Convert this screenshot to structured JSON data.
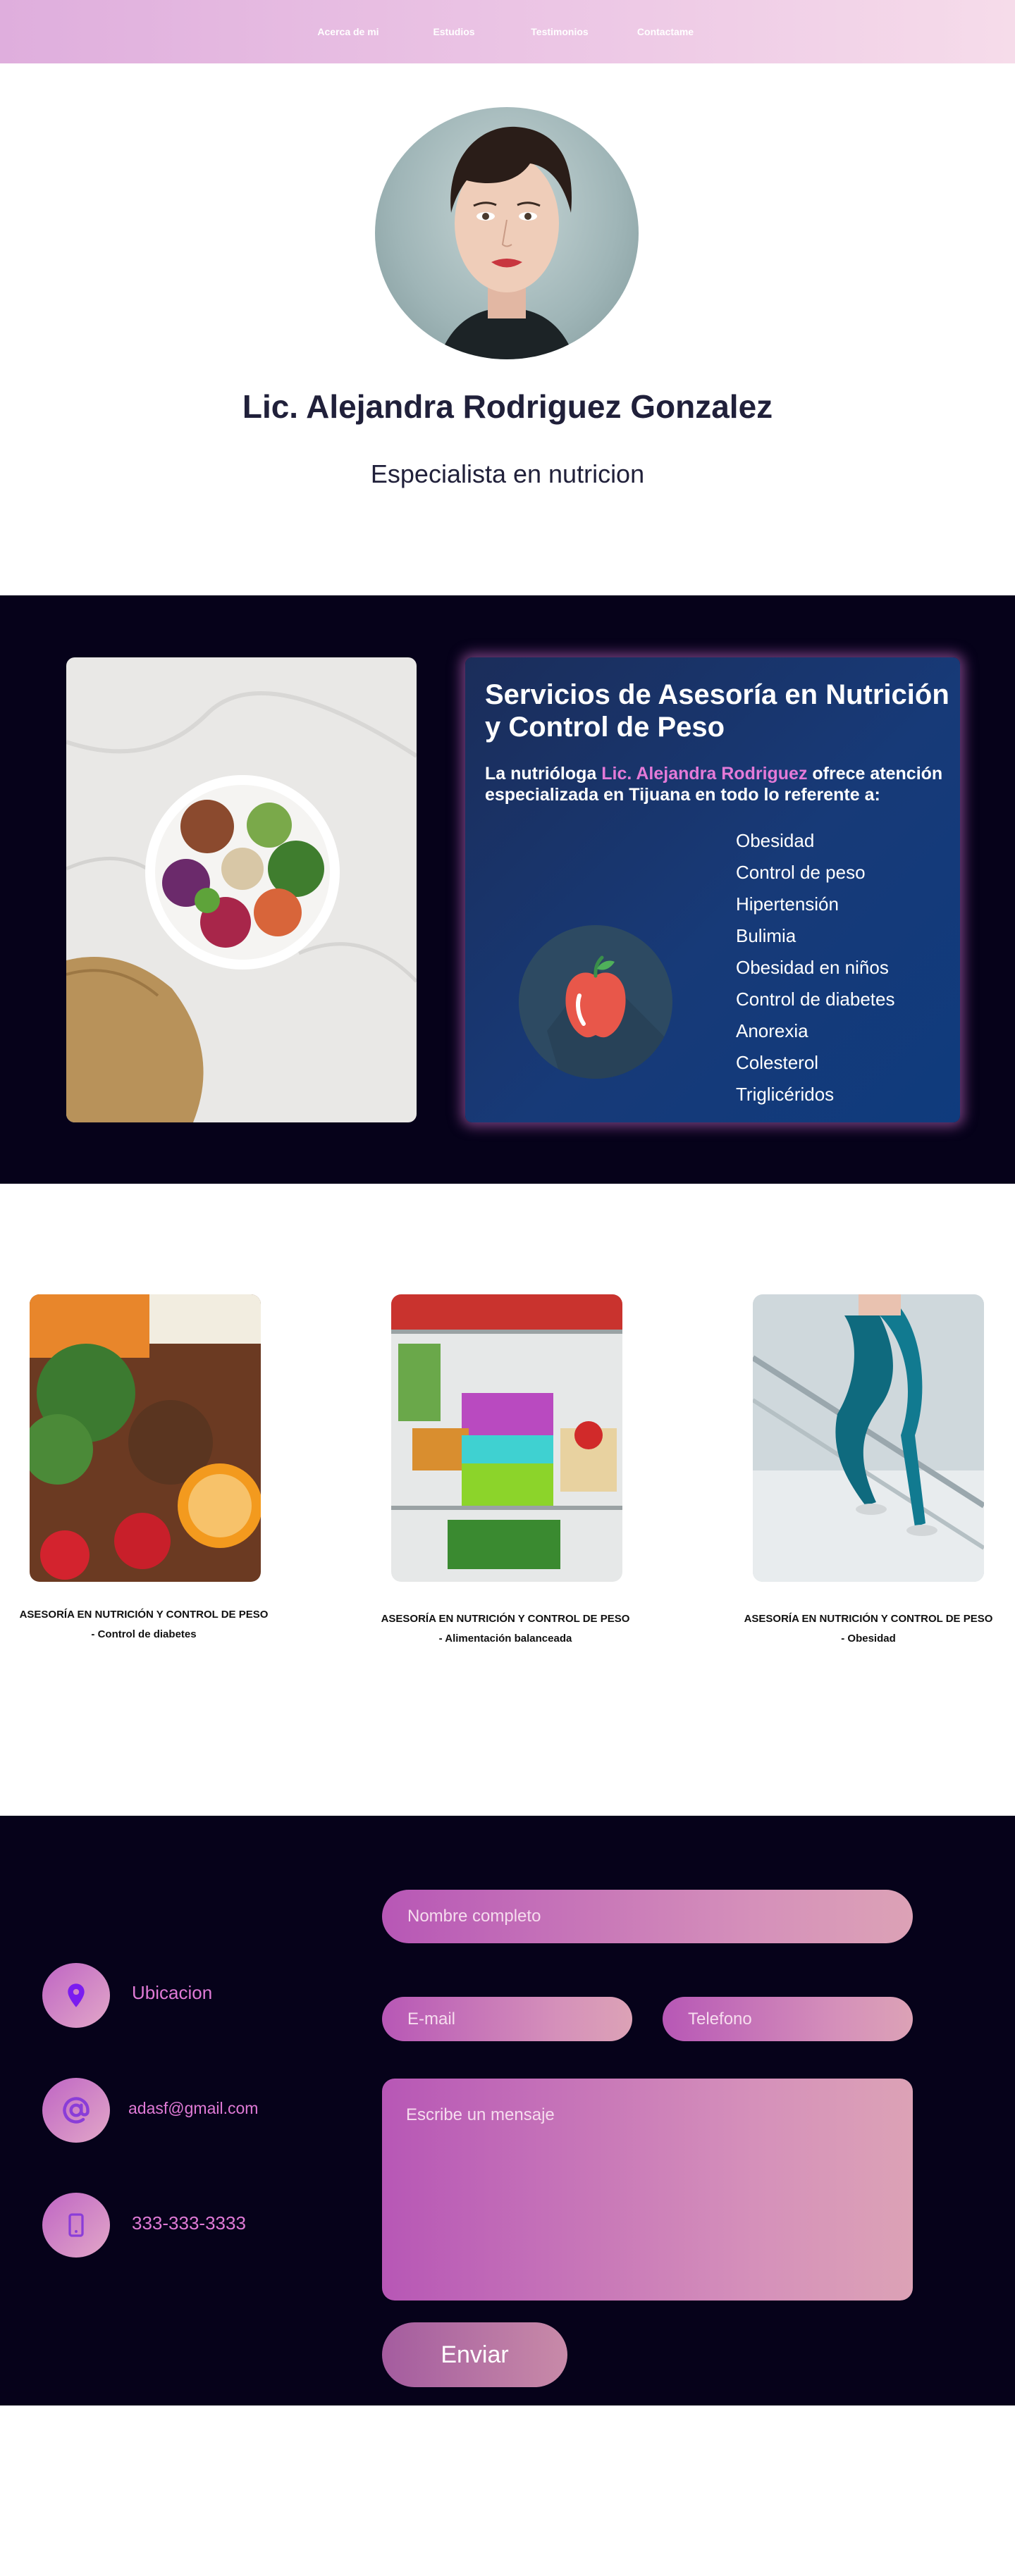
{
  "nav": {
    "links": [
      "Acerca de mi",
      "Estudios",
      "Testimonios",
      "Contactame"
    ]
  },
  "hero": {
    "name": "Lic. Alejandra Rodriguez Gonzalez",
    "subtitle": "Especialista en nutricion"
  },
  "services": {
    "title": "Servicios de Asesoría en Nutrición y Control de Peso",
    "intro_before": "La nutrióloga ",
    "intro_highlight": "Lic. Alejandra Rodriguez",
    "intro_after": " ofrece atención especializada en Tijuana en todo lo referente a:",
    "items": [
      "Obesidad",
      "Control de peso",
      "Hipertensión",
      "Bulimia",
      "Obesidad en niños",
      "Control de diabetes",
      "Anorexia",
      "Colesterol",
      "Triglicéridos"
    ],
    "icon": "apple-icon"
  },
  "advisory": [
    {
      "title": "ASESORÍA EN NUTRICIÓN Y CONTROL DE PESO",
      "subtitle": "- Control de diabetes"
    },
    {
      "title": "ASESORÍA EN NUTRICIÓN Y CONTROL DE PESO",
      "subtitle": "- Alimentación balanceada"
    },
    {
      "title": "ASESORÍA EN NUTRICIÓN Y CONTROL DE PESO",
      "subtitle": "- Obesidad"
    }
  ],
  "contact": {
    "location": "Ubicacion",
    "email": "adasf@gmail.com",
    "phone": "333-333-3333",
    "name_placeholder": "Nombre completo",
    "email_placeholder": "E-mail",
    "phone_placeholder": "Telefono",
    "message_placeholder": "Escribe un mensaje",
    "send_label": "Enviar"
  },
  "colors": {
    "nav_gradient_start": "#dfaedd",
    "dark_bg": "#06021a",
    "accent_pink": "#e07ad6",
    "card_blue": "#173a78",
    "heading_text": "#20203a"
  }
}
